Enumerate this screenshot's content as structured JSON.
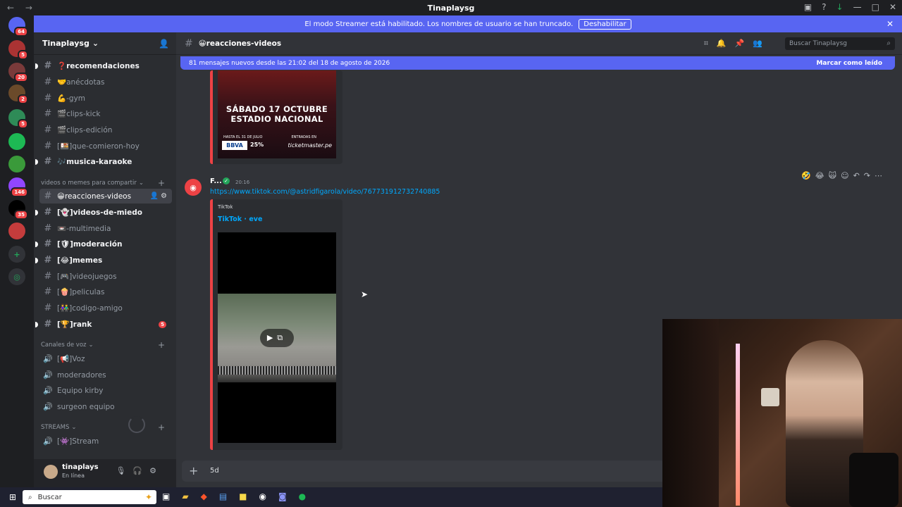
{
  "window": {
    "title": "Tinaplaysg",
    "nav": "← →",
    "controls": [
      "▣",
      "?",
      "↓",
      "—",
      "□",
      "✕"
    ]
  },
  "streamer_banner": {
    "text": "El modo Streamer está habilitado. Los nombres de usuario se han truncado.",
    "button": "Deshabilitar",
    "close": "✕"
  },
  "guilds": [
    {
      "badge": "64",
      "color": "#5865f2"
    },
    {
      "badge": "5",
      "color": "#a33"
    },
    {
      "badge": "20",
      "color": "#7a3a3a"
    },
    {
      "badge": "2",
      "color": "#6b4a2a"
    },
    {
      "badge": "5",
      "color": "#2e8b57"
    },
    {
      "badge": "",
      "color": "#1db954"
    },
    {
      "badge": "",
      "color": "#3a9a3a"
    },
    {
      "badge": "146",
      "color": "#9146ff"
    },
    {
      "badge": "35",
      "color": "#000000"
    },
    {
      "badge": "",
      "color": "#c43c3c"
    }
  ],
  "server": {
    "name": "Tinaplaysg",
    "chevron": "⌄"
  },
  "channels_top": [
    {
      "label": "❓recomendaciones",
      "unread": true
    },
    {
      "label": "🤝anécdotas",
      "unread": false
    },
    {
      "label": "💪-gym",
      "unread": false
    },
    {
      "label": "🎬clips-kick",
      "unread": false
    },
    {
      "label": "🎬clips-edición",
      "unread": false
    },
    {
      "label": "[🍱]que-comieron-hoy",
      "unread": false
    },
    {
      "label": "🎶musica-karaoke",
      "unread": true
    }
  ],
  "category_videos": "videos o memes para compartir",
  "channels_videos": [
    {
      "label": "😀reacciones-videos",
      "active": true
    },
    {
      "label": "[👻]videos-de-miedo",
      "unread": true
    },
    {
      "label": "📼-multimedia",
      "unread": false
    },
    {
      "label": "[🛡]moderación",
      "unread": true
    },
    {
      "label": "[😂]memes",
      "unread": true
    },
    {
      "label": "[🎮]videojuegos",
      "unread": false
    },
    {
      "label": "[🍿]peliculas",
      "unread": false
    },
    {
      "label": "[👫]codigo-amigo",
      "unread": false
    },
    {
      "label": "[🏆]rank",
      "unread": true,
      "mentions": "5"
    }
  ],
  "category_voice": "Canales de voz",
  "voice_channels": [
    "[📢]Voz",
    "moderadores",
    "Equipo kirby",
    "surgeon equipo"
  ],
  "category_streams": "STREAMS",
  "stream_channels": [
    "[👾]Stream"
  ],
  "user": {
    "name": "tinaplays",
    "status": "En línea"
  },
  "channel_header": {
    "name": "😀reacciones-videos",
    "search_placeholder": "Buscar Tinaplaysg"
  },
  "new_messages": {
    "text": "81 mensajes nuevos desde las 21:02 del 18 de agosto de 2026",
    "mark": "Marcar como leído"
  },
  "poster": {
    "line1": "SÁBADO 17 OCTUBRE",
    "line2": "ESTADIO NACIONAL",
    "small": "HASTA EL 31 DE JULIO",
    "entradas": "ENTRADAS EN",
    "bank": "BBVA",
    "discount": "25%",
    "site": "ticketmaster.pe"
  },
  "message": {
    "author": "F...",
    "time": "20:16",
    "link": "https://www.tiktok.com/@astridfigarola/video/767731912732740885",
    "provider": "TikTok",
    "embed_title": "TikTok · eve"
  },
  "composer": {
    "text": "5d"
  },
  "taskbar": {
    "search": "Buscar"
  }
}
